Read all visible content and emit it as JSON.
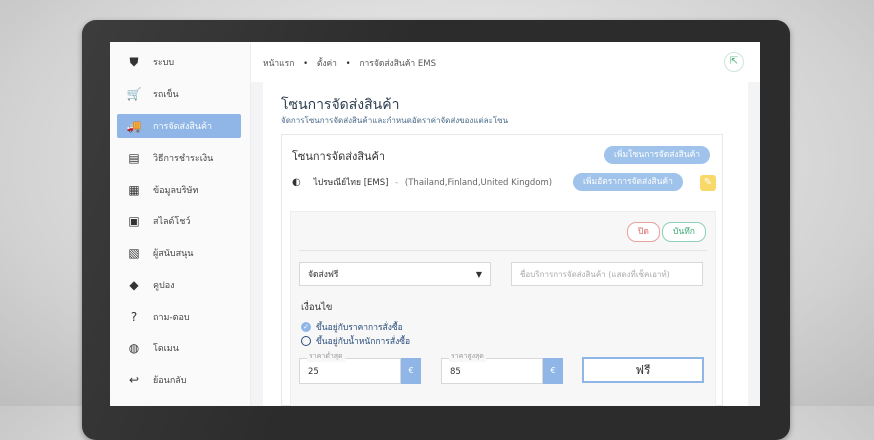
{
  "sidebar": {
    "items": [
      {
        "label": "ระบบ",
        "icon": "shield-icon",
        "glyph": "⛊",
        "active": false
      },
      {
        "label": "รถเข็น",
        "icon": "cart-icon",
        "glyph": "🛒",
        "active": false
      },
      {
        "label": "การจัดส่งสินค้า",
        "icon": "truck-icon",
        "glyph": "🚚",
        "active": true
      },
      {
        "label": "วิธีการชำระเงิน",
        "icon": "payment-icon",
        "glyph": "▤",
        "active": false
      },
      {
        "label": "ข้อมูลบริษัท",
        "icon": "company-icon",
        "glyph": "▦",
        "active": false
      },
      {
        "label": "สไลด์โชว์",
        "icon": "slideshow-icon",
        "glyph": "▣",
        "active": false
      },
      {
        "label": "ผู้สนับสนุน",
        "icon": "image-icon",
        "glyph": "▧",
        "active": false
      },
      {
        "label": "คูปอง",
        "icon": "tag-icon",
        "glyph": "◆",
        "active": false
      },
      {
        "label": "ถาม-ตอบ",
        "icon": "question-icon",
        "glyph": "?",
        "active": false
      },
      {
        "label": "โดเมน",
        "icon": "globe-icon",
        "glyph": "◍",
        "active": false
      },
      {
        "label": "ย้อนกลับ",
        "icon": "back-arrow-icon",
        "glyph": "↩",
        "active": false
      }
    ]
  },
  "breadcrumb": {
    "home": "หน้าแรก",
    "settings": "ตั้งค่า",
    "current": "การจัดส่งสินค้า EMS",
    "separator": "•"
  },
  "header_icon": "export-icon",
  "page": {
    "title": "โซนการจัดส่งสินค้า",
    "subtitle": "จัดการโซนการจัดส่งสินค้าและกำหนดอัตราค่าจัดส่งของแต่ละโซน"
  },
  "zone_card": {
    "title": "โซนการจัดส่งสินค้า",
    "add_zone_button": "เพิ่มโซนการจัดส่งสินค้า",
    "zone_name": "ไปรษณีย์ไทย [EMS]",
    "zone_countries": "(Thailand,Finland,United Kingdom)",
    "zone_dash": "-",
    "add_rate_button": "เพิ่มอัตราการจัดส่งสินค้า"
  },
  "rate_form": {
    "close_button": "ปิด",
    "save_button": "บันทึก",
    "shipping_type_value": "จัดส่งฟรี",
    "service_name_placeholder": "ชื่อบริการการจัดส่งสินค้า (แสดงที่เช็คเอาท์)",
    "condition_label": "เงื่อนไข",
    "conditions": [
      {
        "label": "ขึ้นอยู่กับราคาการสั่งซื้อ",
        "selected": true
      },
      {
        "label": "ขึ้นอยู่กับน้ำหนักการสั่งซื้อ",
        "selected": false
      }
    ],
    "min_price_label": "ราคาต่ำสุด",
    "min_price_value": "25",
    "max_price_label": "ราคาสูงสุด",
    "max_price_value": "85",
    "currency_symbol": "€",
    "rate_value": "ฟรี"
  },
  "colors": {
    "accent": "#8fb6e6",
    "pencil": "#f8d867"
  }
}
